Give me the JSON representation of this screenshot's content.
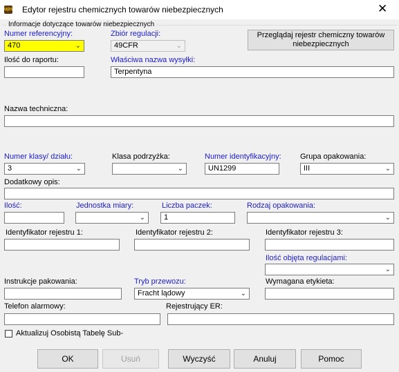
{
  "window": {
    "title": "Edytor rejestru chemicznych towarów niebezpiecznych",
    "icon": "ups-shield-icon",
    "close_glyph": "✕"
  },
  "group": {
    "legend": "Informacje dotyczące towarów niebezpiecznych"
  },
  "fields": {
    "reference_number": {
      "label": "Numer referencyjny:",
      "value": "470"
    },
    "regulation_set": {
      "label": "Zbiór regulacji:",
      "value": "49CFR"
    },
    "browse_button": {
      "label": "Przeglądaj rejestr chemiczny towarów niebezpiecznych"
    },
    "report_quantity": {
      "label": "Ilość do raportu:",
      "value": ""
    },
    "shipping_name": {
      "label": "Właściwa nazwa wysyłki:",
      "value": "Terpentyna"
    },
    "technical_name": {
      "label": "Nazwa techniczna:",
      "value": ""
    },
    "class_division": {
      "label": "Numer klasy/ działu:",
      "value": "3"
    },
    "subsidiary_class": {
      "label": "Klasa podrzyżka:",
      "value": ""
    },
    "id_number": {
      "label": "Numer identyfikacyjny:",
      "value": "UN1299"
    },
    "packing_group": {
      "label": "Grupa opakowania:",
      "value": "III"
    },
    "additional_description": {
      "label": "Dodatkowy opis:",
      "value": ""
    },
    "quantity": {
      "label": "Ilość:",
      "value": ""
    },
    "unit_of_measure": {
      "label": "Jednostka miary:",
      "value": ""
    },
    "package_count": {
      "label": "Liczba paczek:",
      "value": "1"
    },
    "packaging_type": {
      "label": "Rodzaj opakowania:",
      "value": ""
    },
    "registry_id_1": {
      "label": "Identyfikator rejestru 1:",
      "value": ""
    },
    "registry_id_2": {
      "label": "Identyfikator rejestru 2:",
      "value": ""
    },
    "registry_id_3": {
      "label": "Identyfikator rejestru 3:",
      "value": ""
    },
    "regulated_quantity": {
      "label": "Ilość objęta regulacjami:",
      "value": ""
    },
    "packing_instructions": {
      "label": "Instrukcje pakowania:",
      "value": ""
    },
    "transport_mode": {
      "label": "Tryb przewozu:",
      "value": "Fracht lądowy"
    },
    "required_label": {
      "label": "Wymagana etykieta:",
      "value": ""
    },
    "emergency_phone": {
      "label": "Telefon alarmowy:",
      "value": ""
    },
    "er_registrant": {
      "label": "Rejestrujący ER:",
      "value": ""
    },
    "update_table_checkbox": {
      "label": "Aktualizuj Osobistą Tabelę Sub-",
      "checked": false
    }
  },
  "buttons": {
    "ok": "OK",
    "delete": "Usuń",
    "clear": "Wyczyść",
    "cancel": "Anuluj",
    "help": "Pomoc"
  },
  "colors": {
    "required_label": "#1c1cc8",
    "highlight_field": "#ffff00",
    "dialog_bg": "#f0f0f0"
  }
}
